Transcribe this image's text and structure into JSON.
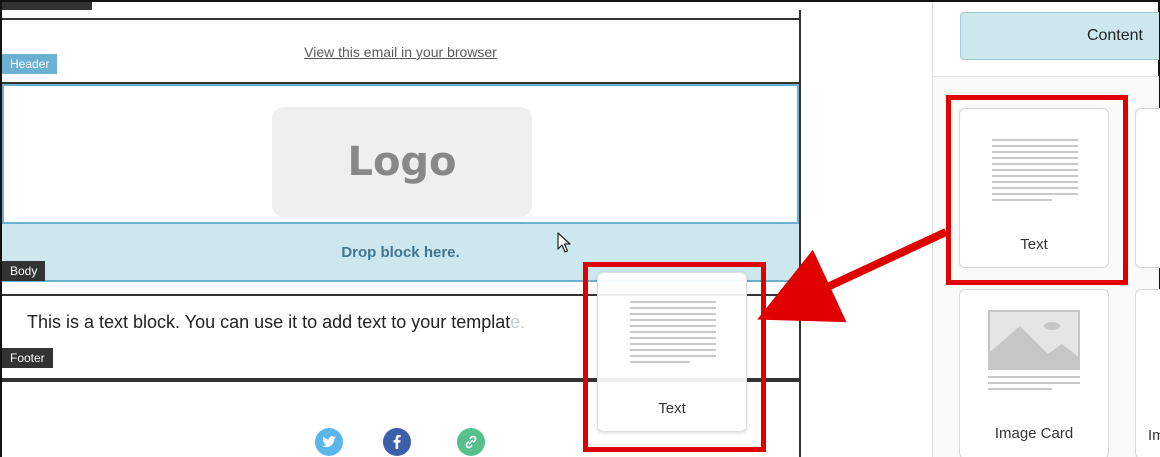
{
  "email": {
    "view_in_browser": "View this email in your browser",
    "tag_header": "Header",
    "tag_body": "Body",
    "tag_footer": "Footer",
    "logo_text": "Logo",
    "drop_zone_text": "Drop block here.",
    "body_text_main": "This is a text block. You can use it to add text to your templat",
    "body_text_faded": "e.",
    "social_icons": [
      "twitter-icon",
      "facebook-icon",
      "link-icon"
    ]
  },
  "drag_ghost": {
    "label": "Text"
  },
  "sidebar": {
    "tab_content": "Content",
    "blocks": [
      {
        "label": "Text",
        "icon": "text-lines-icon"
      },
      {
        "label": "Image Card",
        "icon": "image-card-icon"
      },
      {
        "label": "Im",
        "icon": "image-icon"
      }
    ]
  },
  "colors": {
    "accent_blue": "#6ab0d2",
    "drop_zone_bg": "#cde7ef",
    "highlight_red": "#e00000",
    "twitter": "#5bb6ea",
    "facebook": "#3b5fa8",
    "link": "#56c18d"
  }
}
